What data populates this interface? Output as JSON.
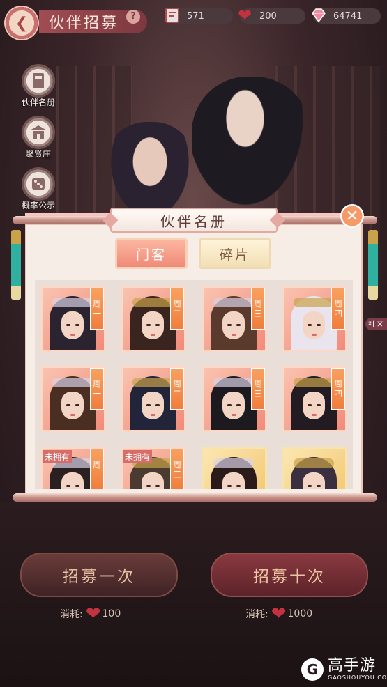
{
  "header": {
    "title": "伙伴招募",
    "help": "?",
    "resources": [
      {
        "icon": "ticket-icon",
        "value": "571"
      },
      {
        "icon": "heart-icon",
        "value": "200"
      },
      {
        "icon": "gem-icon",
        "value": "64741"
      }
    ]
  },
  "side_menu": [
    {
      "label": "伙伴名册",
      "icon": "book-icon"
    },
    {
      "label": "聚贤庄",
      "icon": "pavilion-icon"
    },
    {
      "label": "概率公示",
      "icon": "dice-icon"
    }
  ],
  "edge_badge": "社区",
  "panel": {
    "title": "伙伴名册",
    "tabs": [
      {
        "label": "门客",
        "active": true
      },
      {
        "label": "碎片",
        "active": false
      }
    ],
    "cards": [
      {
        "day": [
          "周",
          "一"
        ],
        "style": "owned",
        "unowned": ""
      },
      {
        "day": [
          "周",
          "二"
        ],
        "style": "owned",
        "unowned": ""
      },
      {
        "day": [
          "周",
          "三"
        ],
        "style": "owned",
        "unowned": ""
      },
      {
        "day": [
          "周",
          "四"
        ],
        "style": "owned",
        "unowned": ""
      },
      {
        "day": [
          "周",
          "一"
        ],
        "style": "owned",
        "unowned": ""
      },
      {
        "day": [
          "周",
          "二"
        ],
        "style": "owned",
        "unowned": ""
      },
      {
        "day": [
          "周",
          "三"
        ],
        "style": "owned",
        "unowned": ""
      },
      {
        "day": [
          "周",
          "四"
        ],
        "style": "owned",
        "unowned": ""
      },
      {
        "day": [
          "周",
          "一"
        ],
        "style": "owned",
        "unowned": "未拥有"
      },
      {
        "day": [
          "周",
          "三"
        ],
        "style": "owned",
        "unowned": "未拥有"
      },
      {
        "day": [
          "",
          ""
        ],
        "style": "gold",
        "unowned": ""
      },
      {
        "day": [
          "",
          ""
        ],
        "style": "gold",
        "unowned": ""
      }
    ]
  },
  "buttons": {
    "recruit_one": "招募一次",
    "recruit_ten": "招募十次"
  },
  "costs": {
    "label": "消耗:",
    "one": "100",
    "ten": "1000"
  },
  "watermark": {
    "logo": "G",
    "name": "高手游",
    "url": "GAOSHOUYOU.COM"
  },
  "colors": {
    "accent": "#f08a78",
    "heart": "#c2323f",
    "day_tag": "#f07d3c"
  }
}
